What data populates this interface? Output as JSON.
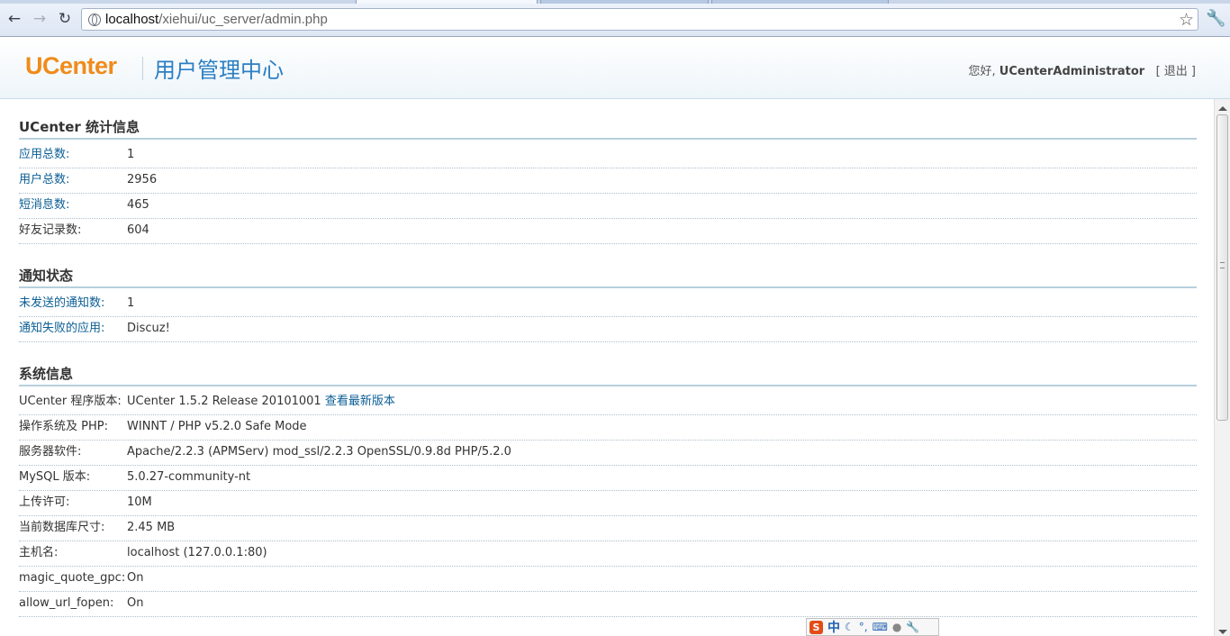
{
  "browser": {
    "url_host": "localhost",
    "url_path": "/xiehui/uc_server/admin.php"
  },
  "header": {
    "logo": "UCenter",
    "subtitle": "用户管理中心",
    "greeting": "您好,",
    "username": "UCenterAdministrator",
    "logout_label": "[ 退出 ]"
  },
  "sections": {
    "stats": {
      "title": "UCenter 统计信息",
      "rows": [
        {
          "label": "应用总数:",
          "value": "1"
        },
        {
          "label": "用户总数:",
          "value": "2956"
        },
        {
          "label": "短消息数:",
          "value": "465"
        },
        {
          "label": "好友记录数:",
          "value": "604"
        }
      ]
    },
    "notify": {
      "title": "通知状态",
      "rows": [
        {
          "label": "未发送的通知数:",
          "value": "1"
        },
        {
          "label": "通知失败的应用:",
          "value": "Discuz!"
        }
      ]
    },
    "system": {
      "title": "系统信息",
      "rows": [
        {
          "label": "UCenter 程序版本:",
          "value": "UCenter 1.5.2 Release 20101001",
          "link": "查看最新版本"
        },
        {
          "label": "操作系统及 PHP:",
          "value": "WINNT / PHP v5.2.0 Safe Mode"
        },
        {
          "label": "服务器软件:",
          "value": "Apache/2.2.3 (APMServ) mod_ssl/2.2.3 OpenSSL/0.9.8d PHP/5.2.0"
        },
        {
          "label": "MySQL 版本:",
          "value": "5.0.27-community-nt"
        },
        {
          "label": "上传许可:",
          "value": "10M"
        },
        {
          "label": "当前数据库尺寸:",
          "value": "2.45 MB"
        },
        {
          "label": "主机名:",
          "value": "localhost (127.0.0.1:80)"
        },
        {
          "label": "magic_quote_gpc:",
          "value": "On"
        },
        {
          "label": "allow_url_fopen:",
          "value": "On"
        }
      ]
    }
  },
  "ime": {
    "logo": "S",
    "mode": "中",
    "icons": [
      "moon-icon",
      "punctuation-icon",
      "keyboard-icon",
      "user-icon",
      "wrench-icon"
    ]
  }
}
